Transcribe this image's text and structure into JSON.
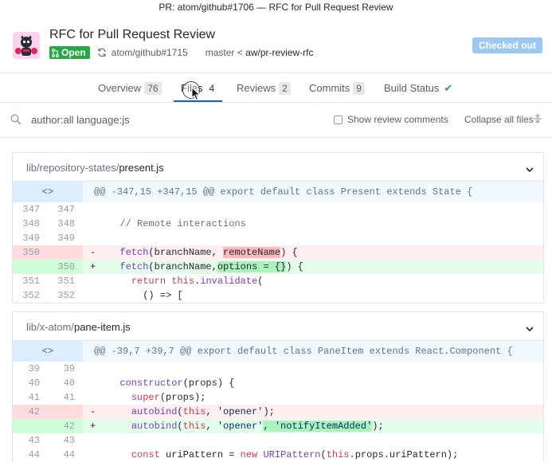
{
  "window_title": "PR: atom/github#1706 — RFC for Pull Request Review",
  "header": {
    "title": "RFC for Pull Request Review",
    "status_badge": "Open",
    "repo_ref": "atom/github#1715",
    "base_branch": "master",
    "separator": "<",
    "head_branch": "aw/pr-review-rfc",
    "checked_out_label": "Checked out"
  },
  "tabs": [
    {
      "label": "Overview",
      "count": "76"
    },
    {
      "label": "Files",
      "count": "4"
    },
    {
      "label": "Reviews",
      "count": "2"
    },
    {
      "label": "Commits",
      "count": "9"
    },
    {
      "label": "Build Status",
      "count": ""
    }
  ],
  "filter": {
    "query": "author:all language:js",
    "show_review_comments_label": "Show review comments",
    "collapse_label": "Collapse all files"
  },
  "files": [
    {
      "dir": "lib/repository-states/",
      "name": "present.js",
      "hunk_header": "@@ -347,15 +347,15 @@ export default class Present extends State {",
      "lines": [
        {
          "type": "ctx",
          "old": "347",
          "new": "347",
          "text": ""
        },
        {
          "type": "ctx",
          "old": "348",
          "new": "348",
          "text": "  // Remote interactions"
        },
        {
          "type": "ctx",
          "old": "349",
          "new": "349",
          "text": ""
        },
        {
          "type": "del",
          "old": "350",
          "new": "",
          "text": "  fetch(branchName, remoteName) {"
        },
        {
          "type": "add",
          "old": "",
          "new": "350",
          "text": "  fetch(branchName,options = {}) {"
        },
        {
          "type": "ctx",
          "old": "351",
          "new": "351",
          "text": "    return this.invalidate("
        },
        {
          "type": "ctx",
          "old": "352",
          "new": "352",
          "text": "      () => ["
        }
      ]
    },
    {
      "dir": "lib/x-atom/",
      "name": "pane-item.js",
      "hunk_header": "@@ -39,7 +39,7 @@ export default class PaneItem extends React.Component {",
      "lines": [
        {
          "type": "ctx",
          "old": "39",
          "new": "39",
          "text": ""
        },
        {
          "type": "ctx",
          "old": "40",
          "new": "40",
          "text": "  constructor(props) {"
        },
        {
          "type": "ctx",
          "old": "41",
          "new": "41",
          "text": "    super(props);"
        },
        {
          "type": "del",
          "old": "42",
          "new": "",
          "text": "    autobind(this, 'opener');"
        },
        {
          "type": "add",
          "old": "",
          "new": "42",
          "text": "    autobind(this, 'opener', 'notifyItemAdded');"
        },
        {
          "type": "ctx",
          "old": "43",
          "new": "43",
          "text": ""
        },
        {
          "type": "ctx",
          "old": "44",
          "new": "44",
          "text": "    const uriPattern = new URIPattern(this.props.uriPattern);"
        }
      ]
    }
  ],
  "colors": {
    "accent": "#0366d6",
    "open_green": "#28a745",
    "checked_out_bg": "#9cc8f4",
    "deletion_bg": "#ffeef0",
    "addition_bg": "#e6ffed"
  }
}
